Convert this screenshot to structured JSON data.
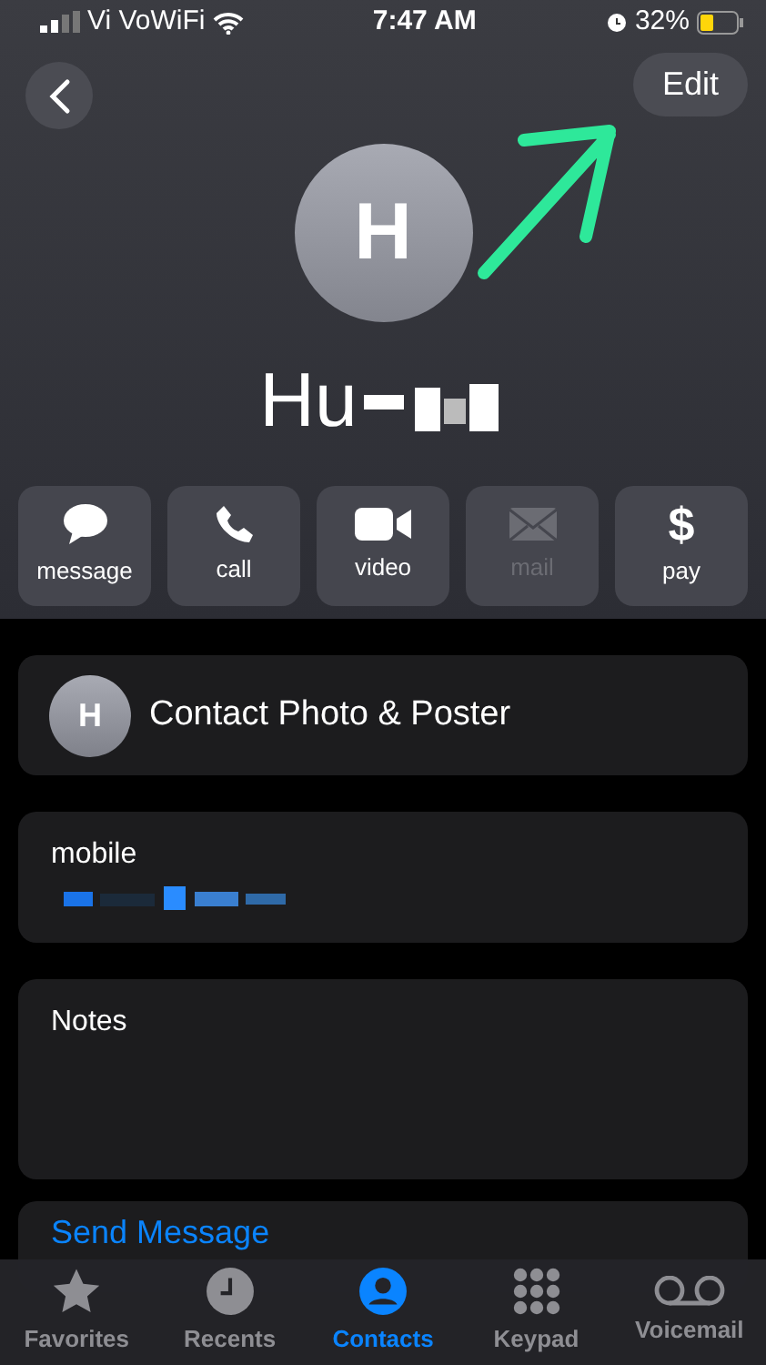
{
  "status_bar": {
    "carrier": "Vi VoWiFi",
    "time": "7:47 AM",
    "battery": "32%"
  },
  "header": {
    "edit": "Edit"
  },
  "contact": {
    "initial": "H",
    "name": "Hu"
  },
  "actions": [
    {
      "kind": "message",
      "label": "message",
      "disabled": false
    },
    {
      "kind": "call",
      "label": "call",
      "disabled": false
    },
    {
      "kind": "video",
      "label": "video",
      "disabled": false
    },
    {
      "kind": "mail",
      "label": "mail",
      "disabled": true
    },
    {
      "kind": "pay",
      "symbol": "$",
      "label": "pay",
      "disabled": false
    }
  ],
  "photo_row": {
    "initial": "H",
    "label": "Contact Photo & Poster"
  },
  "phone": {
    "label": "mobile"
  },
  "notes": {
    "label": "Notes"
  },
  "send_message": "Send Message",
  "tabs": [
    {
      "kind": "favorites",
      "label": "Favorites",
      "selected": false
    },
    {
      "kind": "recents",
      "label": "Recents",
      "selected": false
    },
    {
      "kind": "contacts",
      "label": "Contacts",
      "selected": true
    },
    {
      "kind": "keypad",
      "label": "Keypad",
      "selected": false
    },
    {
      "kind": "voicemail",
      "label": "Voicemail",
      "selected": false
    }
  ]
}
